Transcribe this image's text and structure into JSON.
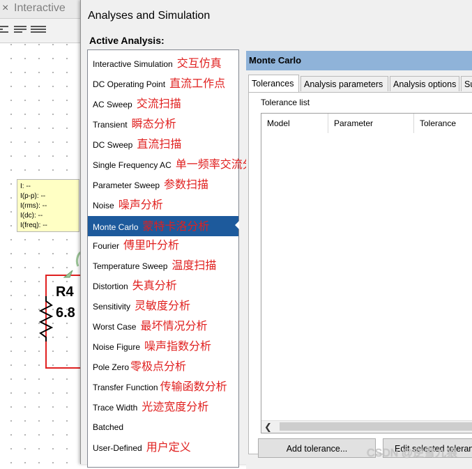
{
  "background": {
    "title": "Interactive",
    "probe_lines": [
      "I: --",
      "I(p-p): --",
      "I(rms): --",
      "I(dc): --",
      "I(freq): --"
    ],
    "resistor_ref": "R4",
    "resistor_value": "6.8"
  },
  "dialog": {
    "title": "Analyses and Simulation",
    "active_label": "Active Analysis:",
    "analyses": [
      {
        "label": "Interactive Simulation",
        "note": "交互仿真"
      },
      {
        "label": "DC Operating Point",
        "note": "直流工作点"
      },
      {
        "label": "AC Sweep",
        "note": "交流扫描"
      },
      {
        "label": "Transient",
        "note": "瞬态分析"
      },
      {
        "label": "DC Sweep",
        "note": "直流扫描"
      },
      {
        "label": "Single Frequency AC",
        "note": "单一频率交流分析"
      },
      {
        "label": "Parameter Sweep",
        "note": "参数扫描"
      },
      {
        "label": "Noise",
        "note": "噪声分析"
      },
      {
        "label": "Monte Carlo",
        "note": "蒙特卡洛分析"
      },
      {
        "label": "Fourier",
        "note": "傅里叶分析"
      },
      {
        "label": "Temperature Sweep",
        "note": "温度扫描"
      },
      {
        "label": "Distortion",
        "note": "失真分析"
      },
      {
        "label": "Sensitivity",
        "note": "灵敏度分析"
      },
      {
        "label": "Worst Case",
        "note": "最坏情况分析"
      },
      {
        "label": "Noise Figure",
        "note": "噪声指数分析"
      },
      {
        "label": "Pole Zero",
        "note": "零极点分析"
      },
      {
        "label": "Transfer Function",
        "note": "传输函数分析"
      },
      {
        "label": "Trace Width",
        "note": "光迹宽度分析"
      },
      {
        "label": "Batched",
        "note": ""
      },
      {
        "label": "User-Defined",
        "note": "用户定义"
      }
    ],
    "selected_analysis": "Monte Carlo",
    "panel": {
      "header": "Monte Carlo",
      "tabs": [
        "Tolerances",
        "Analysis parameters",
        "Analysis options",
        "Su"
      ],
      "tolerance_list_label": "Tolerance list",
      "columns": [
        "Model",
        "Parameter",
        "Tolerance"
      ],
      "buttons": {
        "add": "Add tolerance...",
        "edit": "Edit selected tolerance"
      }
    }
  },
  "watermark": "CSDN @逆雪九狼"
}
